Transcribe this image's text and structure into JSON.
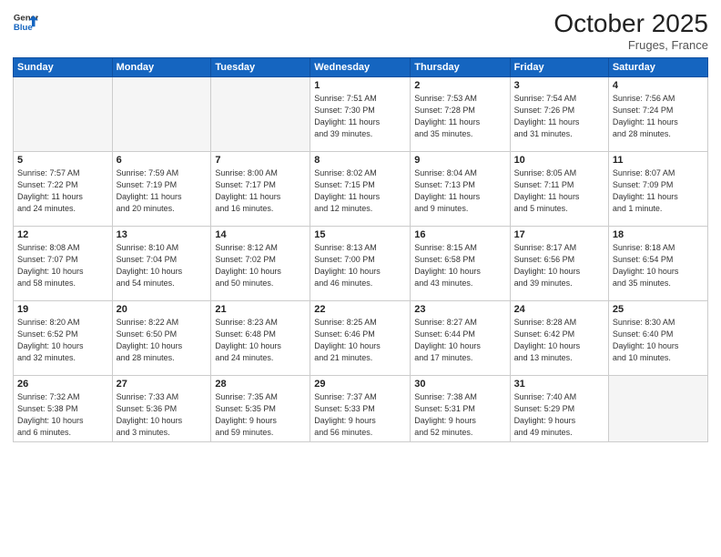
{
  "header": {
    "logo_line1": "General",
    "logo_line2": "Blue",
    "month": "October 2025",
    "location": "Fruges, France"
  },
  "days_of_week": [
    "Sunday",
    "Monday",
    "Tuesday",
    "Wednesday",
    "Thursday",
    "Friday",
    "Saturday"
  ],
  "weeks": [
    [
      {
        "day": "",
        "info": ""
      },
      {
        "day": "",
        "info": ""
      },
      {
        "day": "",
        "info": ""
      },
      {
        "day": "1",
        "info": "Sunrise: 7:51 AM\nSunset: 7:30 PM\nDaylight: 11 hours\nand 39 minutes."
      },
      {
        "day": "2",
        "info": "Sunrise: 7:53 AM\nSunset: 7:28 PM\nDaylight: 11 hours\nand 35 minutes."
      },
      {
        "day": "3",
        "info": "Sunrise: 7:54 AM\nSunset: 7:26 PM\nDaylight: 11 hours\nand 31 minutes."
      },
      {
        "day": "4",
        "info": "Sunrise: 7:56 AM\nSunset: 7:24 PM\nDaylight: 11 hours\nand 28 minutes."
      }
    ],
    [
      {
        "day": "5",
        "info": "Sunrise: 7:57 AM\nSunset: 7:22 PM\nDaylight: 11 hours\nand 24 minutes."
      },
      {
        "day": "6",
        "info": "Sunrise: 7:59 AM\nSunset: 7:19 PM\nDaylight: 11 hours\nand 20 minutes."
      },
      {
        "day": "7",
        "info": "Sunrise: 8:00 AM\nSunset: 7:17 PM\nDaylight: 11 hours\nand 16 minutes."
      },
      {
        "day": "8",
        "info": "Sunrise: 8:02 AM\nSunset: 7:15 PM\nDaylight: 11 hours\nand 12 minutes."
      },
      {
        "day": "9",
        "info": "Sunrise: 8:04 AM\nSunset: 7:13 PM\nDaylight: 11 hours\nand 9 minutes."
      },
      {
        "day": "10",
        "info": "Sunrise: 8:05 AM\nSunset: 7:11 PM\nDaylight: 11 hours\nand 5 minutes."
      },
      {
        "day": "11",
        "info": "Sunrise: 8:07 AM\nSunset: 7:09 PM\nDaylight: 11 hours\nand 1 minute."
      }
    ],
    [
      {
        "day": "12",
        "info": "Sunrise: 8:08 AM\nSunset: 7:07 PM\nDaylight: 10 hours\nand 58 minutes."
      },
      {
        "day": "13",
        "info": "Sunrise: 8:10 AM\nSunset: 7:04 PM\nDaylight: 10 hours\nand 54 minutes."
      },
      {
        "day": "14",
        "info": "Sunrise: 8:12 AM\nSunset: 7:02 PM\nDaylight: 10 hours\nand 50 minutes."
      },
      {
        "day": "15",
        "info": "Sunrise: 8:13 AM\nSunset: 7:00 PM\nDaylight: 10 hours\nand 46 minutes."
      },
      {
        "day": "16",
        "info": "Sunrise: 8:15 AM\nSunset: 6:58 PM\nDaylight: 10 hours\nand 43 minutes."
      },
      {
        "day": "17",
        "info": "Sunrise: 8:17 AM\nSunset: 6:56 PM\nDaylight: 10 hours\nand 39 minutes."
      },
      {
        "day": "18",
        "info": "Sunrise: 8:18 AM\nSunset: 6:54 PM\nDaylight: 10 hours\nand 35 minutes."
      }
    ],
    [
      {
        "day": "19",
        "info": "Sunrise: 8:20 AM\nSunset: 6:52 PM\nDaylight: 10 hours\nand 32 minutes."
      },
      {
        "day": "20",
        "info": "Sunrise: 8:22 AM\nSunset: 6:50 PM\nDaylight: 10 hours\nand 28 minutes."
      },
      {
        "day": "21",
        "info": "Sunrise: 8:23 AM\nSunset: 6:48 PM\nDaylight: 10 hours\nand 24 minutes."
      },
      {
        "day": "22",
        "info": "Sunrise: 8:25 AM\nSunset: 6:46 PM\nDaylight: 10 hours\nand 21 minutes."
      },
      {
        "day": "23",
        "info": "Sunrise: 8:27 AM\nSunset: 6:44 PM\nDaylight: 10 hours\nand 17 minutes."
      },
      {
        "day": "24",
        "info": "Sunrise: 8:28 AM\nSunset: 6:42 PM\nDaylight: 10 hours\nand 13 minutes."
      },
      {
        "day": "25",
        "info": "Sunrise: 8:30 AM\nSunset: 6:40 PM\nDaylight: 10 hours\nand 10 minutes."
      }
    ],
    [
      {
        "day": "26",
        "info": "Sunrise: 7:32 AM\nSunset: 5:38 PM\nDaylight: 10 hours\nand 6 minutes."
      },
      {
        "day": "27",
        "info": "Sunrise: 7:33 AM\nSunset: 5:36 PM\nDaylight: 10 hours\nand 3 minutes."
      },
      {
        "day": "28",
        "info": "Sunrise: 7:35 AM\nSunset: 5:35 PM\nDaylight: 9 hours\nand 59 minutes."
      },
      {
        "day": "29",
        "info": "Sunrise: 7:37 AM\nSunset: 5:33 PM\nDaylight: 9 hours\nand 56 minutes."
      },
      {
        "day": "30",
        "info": "Sunrise: 7:38 AM\nSunset: 5:31 PM\nDaylight: 9 hours\nand 52 minutes."
      },
      {
        "day": "31",
        "info": "Sunrise: 7:40 AM\nSunset: 5:29 PM\nDaylight: 9 hours\nand 49 minutes."
      },
      {
        "day": "",
        "info": ""
      }
    ]
  ]
}
